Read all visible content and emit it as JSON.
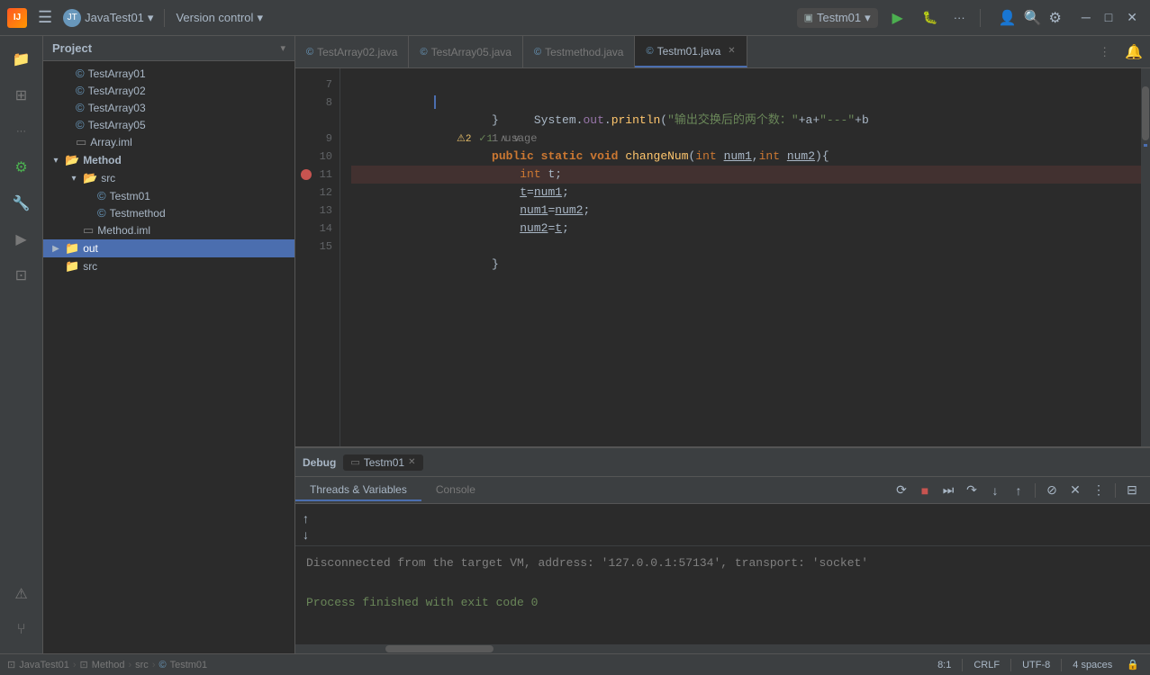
{
  "titleBar": {
    "logoText": "IJ",
    "projectName": "JavaTest01",
    "projectDropdown": "▾",
    "versionControl": "Version control",
    "vcDropdown": "▾",
    "runConfig": "Testm01",
    "runDropdown": "▾",
    "moreLabel": "···",
    "winMin": "─",
    "winMax": "□",
    "winClose": "✕"
  },
  "tabs": [
    {
      "id": "tab1",
      "label": "TestArray02.java",
      "icon": "©",
      "active": false,
      "closable": false
    },
    {
      "id": "tab2",
      "label": "TestArray05.java",
      "icon": "©",
      "active": false,
      "closable": false
    },
    {
      "id": "tab3",
      "label": "Testmethod.java",
      "icon": "©",
      "active": false,
      "closable": false
    },
    {
      "id": "tab4",
      "label": "Testm01.java",
      "icon": "©",
      "active": true,
      "closable": true
    }
  ],
  "codeLines": [
    {
      "num": "7",
      "text": "            System.out.println(\"输出交换后的两个数：\"+a+\"---\"+b",
      "hasWarning": true,
      "warnCount": "2",
      "checkCount": "1"
    },
    {
      "num": "8",
      "text": "        }"
    },
    {
      "num": "",
      "text": "        1 usage",
      "isUsage": true
    },
    {
      "num": "9",
      "text": "        public static void changeNum(int num1,int num2){"
    },
    {
      "num": "10",
      "text": "            int t;"
    },
    {
      "num": "11",
      "text": "            t=num1;",
      "hasBreakpoint": true
    },
    {
      "num": "12",
      "text": "            num1=num2;"
    },
    {
      "num": "13",
      "text": "            num2=t;"
    },
    {
      "num": "14",
      "text": ""
    },
    {
      "num": "15",
      "text": "        }"
    }
  ],
  "debugPanel": {
    "tabLabel": "Debug",
    "fileTabLabel": "Testm01",
    "sectionTabs": [
      "Threads & Variables",
      "Console"
    ],
    "activeSection": "Console",
    "toolbarButtons": [
      "rerun",
      "stop",
      "resume",
      "step-over",
      "step-into",
      "step-out",
      "mute",
      "clear",
      "more"
    ],
    "consoleLines": [
      {
        "text": "Disconnected from the target VM, address: '127.0.0.1:57134', transport: 'socket'",
        "type": "gray"
      },
      {
        "text": ""
      },
      {
        "text": "Process finished with exit code 0",
        "type": "green"
      }
    ]
  },
  "statusBar": {
    "breadcrumb": [
      "JavaTest01",
      "Method",
      "src",
      "Testm01"
    ],
    "position": "8:1",
    "lineEnding": "CRLF",
    "encoding": "UTF-8",
    "indent": "4 spaces"
  },
  "sidebar": {
    "items": [
      {
        "id": "folder",
        "icon": "📁",
        "active": false
      },
      {
        "id": "extensions",
        "icon": "⊞",
        "active": false
      },
      {
        "id": "more-tools",
        "icon": "···",
        "active": false
      },
      {
        "id": "run-debug",
        "icon": "⚙",
        "active": true
      },
      {
        "id": "tools",
        "icon": "🔧",
        "active": false
      },
      {
        "id": "plugins",
        "icon": "▶",
        "active": false
      },
      {
        "id": "terminal",
        "icon": "⊡",
        "active": false
      },
      {
        "id": "problems",
        "icon": "⚠",
        "active": false
      },
      {
        "id": "vcs",
        "icon": "⑂",
        "active": false
      }
    ]
  },
  "projectTree": {
    "title": "Project",
    "items": [
      {
        "id": "testarray01",
        "name": "TestArray01",
        "type": "java",
        "indent": 0,
        "icon": "©"
      },
      {
        "id": "testarray02",
        "name": "TestArray02",
        "type": "java",
        "indent": 0,
        "icon": "©"
      },
      {
        "id": "testarray03",
        "name": "TestArray03",
        "type": "java",
        "indent": 0,
        "icon": "©"
      },
      {
        "id": "testarray05",
        "name": "TestArray05",
        "type": "java",
        "indent": 0,
        "icon": "©"
      },
      {
        "id": "array-iml",
        "name": "Array.iml",
        "type": "iml",
        "indent": 0
      },
      {
        "id": "method",
        "name": "Method",
        "type": "folder",
        "indent": 0,
        "expanded": true
      },
      {
        "id": "src",
        "name": "src",
        "type": "folder",
        "indent": 1,
        "expanded": true
      },
      {
        "id": "testm01",
        "name": "Testm01",
        "type": "java",
        "indent": 2,
        "icon": "©"
      },
      {
        "id": "testmethod",
        "name": "Testmethod",
        "type": "java",
        "indent": 2,
        "icon": "©"
      },
      {
        "id": "method-iml",
        "name": "Method.iml",
        "type": "iml",
        "indent": 1
      },
      {
        "id": "out",
        "name": "out",
        "type": "folder",
        "indent": 0,
        "expanded": false,
        "selected": true
      },
      {
        "id": "src2",
        "name": "src",
        "type": "folder",
        "indent": 0,
        "partial": true
      }
    ]
  }
}
